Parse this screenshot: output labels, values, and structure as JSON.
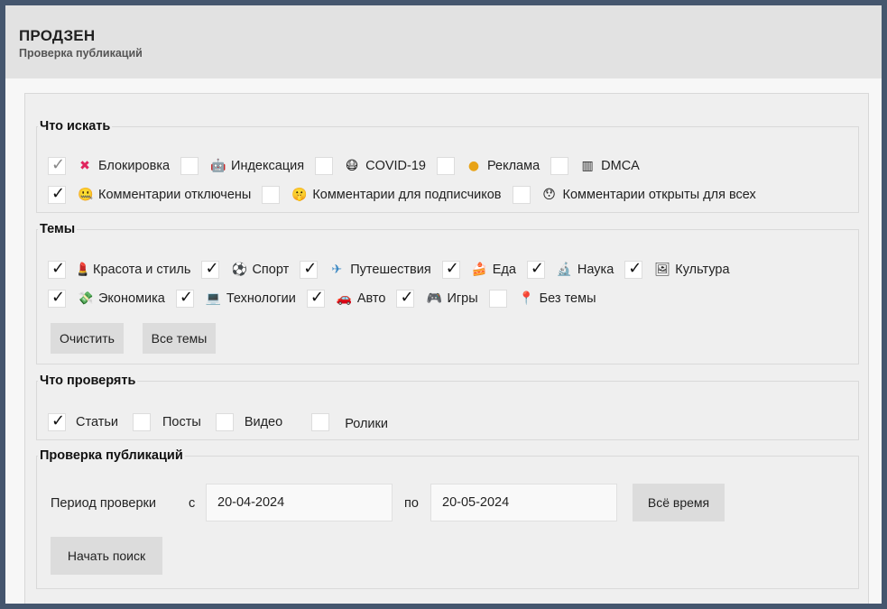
{
  "app": {
    "title": "ПРОДЗЕН",
    "subtitle": "Проверка публикаций"
  },
  "search": {
    "legend": "Что искать",
    "options": [
      {
        "label": "Блокировка",
        "icon": "❌",
        "checked": true
      },
      {
        "label": "Индексация",
        "icon": "🤖",
        "checked": false
      },
      {
        "label": "COVID-19",
        "icon": "😷",
        "checked": false
      },
      {
        "label": "Реклама",
        "icon": "🪙",
        "checked": false
      },
      {
        "label": "DMCA",
        "icon": "🎹",
        "checked": false
      },
      {
        "label": "Комментарии отключены",
        "icon": "🤐",
        "checked": true
      },
      {
        "label": "Комментарии для подписчиков",
        "icon": "🤫",
        "checked": false
      },
      {
        "label": "Комментарии открыты для всех",
        "icon": "😯",
        "checked": false
      }
    ]
  },
  "topics": {
    "legend": "Темы",
    "options": [
      {
        "label": "Красота и стиль",
        "icon": "💄",
        "checked": true
      },
      {
        "label": "Спорт",
        "icon": "⚽",
        "checked": true
      },
      {
        "label": "Путешествия",
        "icon": "✈",
        "checked": true
      },
      {
        "label": "Еда",
        "icon": "🍰",
        "checked": true
      },
      {
        "label": "Наука",
        "icon": "🔬",
        "checked": true
      },
      {
        "label": "Культура",
        "icon": "🖼",
        "checked": true
      },
      {
        "label": "Экономика",
        "icon": "💸",
        "checked": true
      },
      {
        "label": "Технологии",
        "icon": "💻",
        "checked": true
      },
      {
        "label": "Авто",
        "icon": "🚗",
        "checked": true
      },
      {
        "label": "Игры",
        "icon": "🎮",
        "checked": true
      },
      {
        "label": "Без темы",
        "icon": "📍",
        "checked": false
      }
    ],
    "clear_label": "Очистить",
    "all_label": "Все темы"
  },
  "check_types": {
    "legend": "Что проверять",
    "options": [
      {
        "label": "Статьи",
        "checked": true
      },
      {
        "label": "Посты",
        "checked": false
      },
      {
        "label": "Видео",
        "checked": false
      },
      {
        "label": "Ролики",
        "checked": false
      }
    ]
  },
  "check": {
    "legend": "Проверка публикаций",
    "period_label": "Период проверки",
    "from_label": "с",
    "from_value": "20-04-2024",
    "to_label": "по",
    "to_value": "20-05-2024",
    "all_time_label": "Всё время",
    "start_label": "Начать поиск"
  }
}
